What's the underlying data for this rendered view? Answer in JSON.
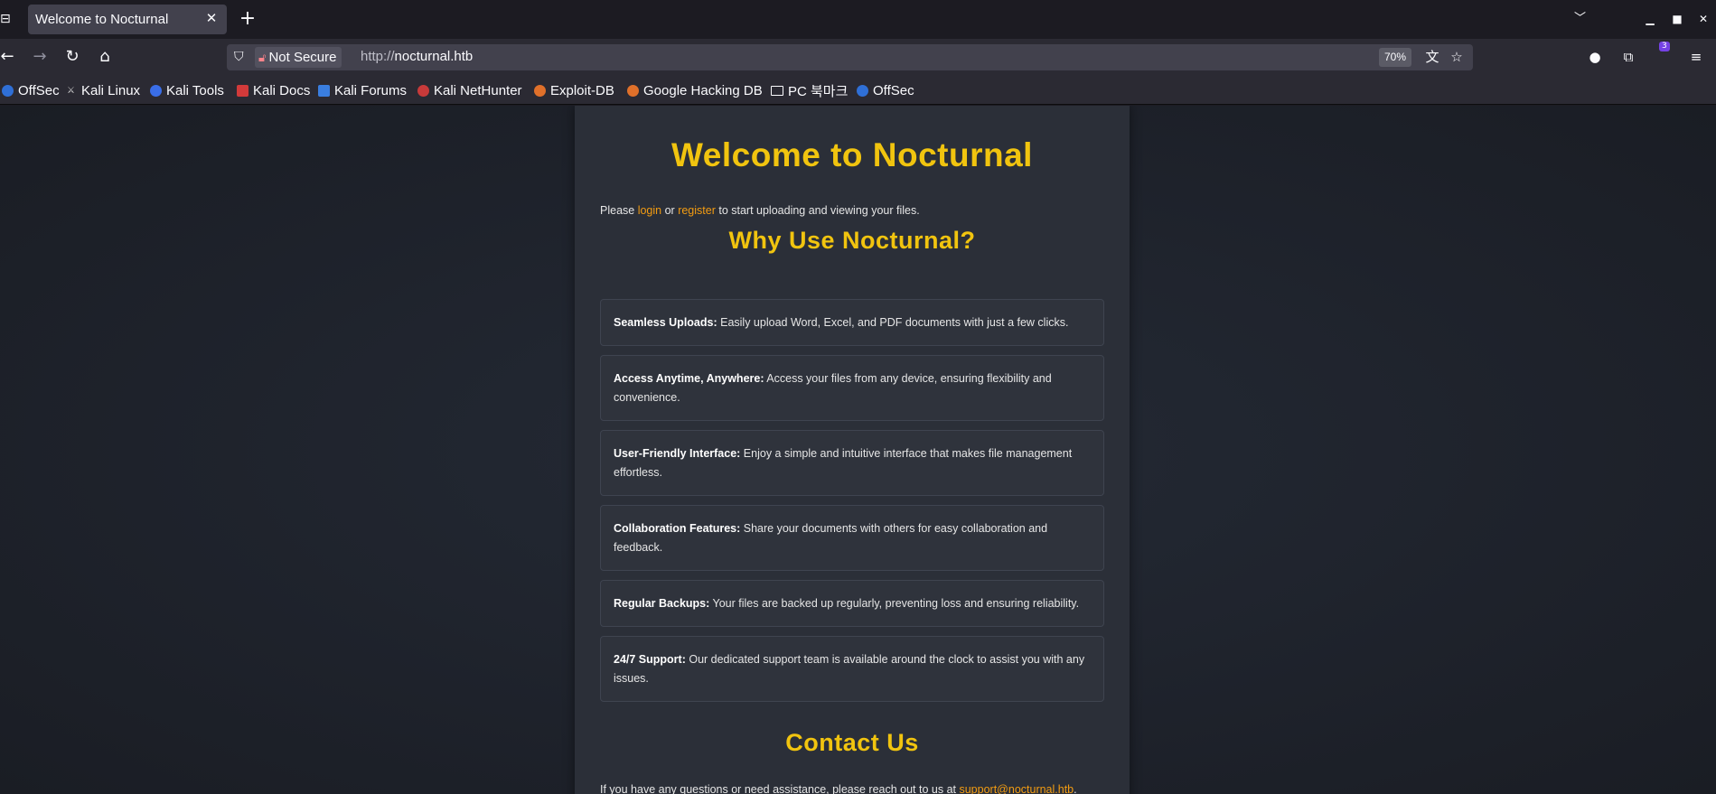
{
  "browser": {
    "tab_title": "Welcome to Nocturnal",
    "security_label": "Not Secure",
    "url_scheme": "http://",
    "url_host": "nocturnal.htb",
    "zoom": "70%",
    "extensions_badge": "3",
    "bookmarks": [
      {
        "label": "OffSec",
        "icon": "offsec-icon"
      },
      {
        "label": "Kali Linux",
        "icon": "kali-icon"
      },
      {
        "label": "Kali Tools",
        "icon": "kali-tools-icon"
      },
      {
        "label": "Kali Docs",
        "icon": "kali-docs-icon"
      },
      {
        "label": "Kali Forums",
        "icon": "kali-forums-icon"
      },
      {
        "label": "Kali NetHunter",
        "icon": "nethunter-icon"
      },
      {
        "label": "Exploit-DB",
        "icon": "exploit-db-icon"
      },
      {
        "label": "Google Hacking DB",
        "icon": "ghdb-icon"
      },
      {
        "label": "PC 북마크",
        "icon": "folder-icon"
      },
      {
        "label": "OffSec",
        "icon": "offsec-icon"
      }
    ]
  },
  "page": {
    "title": "Welcome to Nocturnal",
    "intro": {
      "before": "Please ",
      "login": "login",
      "middle": " or ",
      "register": "register",
      "after": " to start uploading and viewing your files."
    },
    "why_heading": "Why Use Nocturnal?",
    "features": [
      {
        "title": "Seamless Uploads:",
        "text": " Easily upload Word, Excel, and PDF documents with just a few clicks."
      },
      {
        "title": "Access Anytime, Anywhere:",
        "text": " Access your files from any device, ensuring flexibility and convenience."
      },
      {
        "title": "User-Friendly Interface:",
        "text": " Enjoy a simple and intuitive interface that makes file management effortless."
      },
      {
        "title": "Collaboration Features:",
        "text": " Share your documents with others for easy collaboration and feedback."
      },
      {
        "title": "Regular Backups:",
        "text": " Your files are backed up regularly, preventing loss and ensuring reliability."
      },
      {
        "title": "24/7 Support:",
        "text": " Our dedicated support team is available around the clock to assist you with any issues."
      }
    ],
    "contact_heading": "Contact Us",
    "contact": {
      "text": "If you have any questions or need assistance, please reach out to us at ",
      "email": "support@nocturnal.htb",
      "end": "."
    }
  },
  "colors": {
    "accent_yellow": "#f1c40f",
    "link_orange": "#f39c12",
    "panel": "#2b2f38",
    "background": "#1e222b"
  }
}
